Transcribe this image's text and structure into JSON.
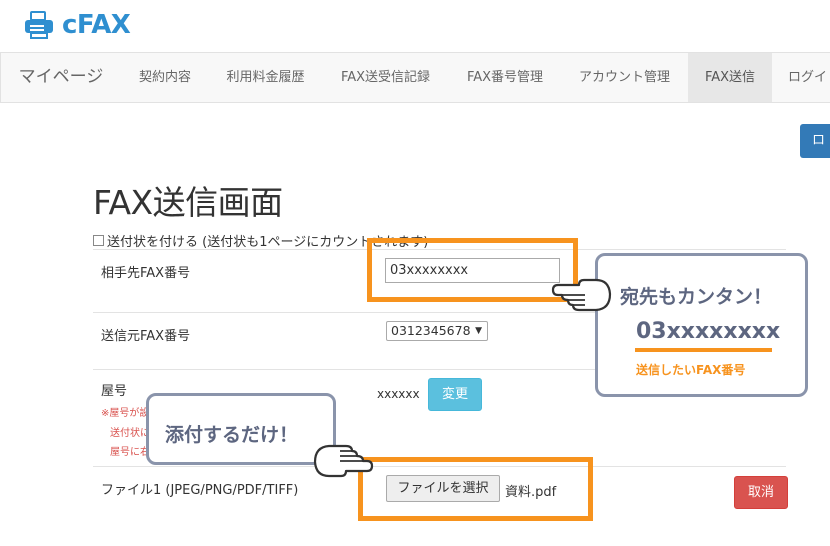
{
  "brand": {
    "logo_text": "cFAX"
  },
  "nav": {
    "home": "マイページ",
    "items": [
      "契約内容",
      "利用料金履歴",
      "FAX送受信記録",
      "FAX番号管理",
      "アカウント管理",
      "FAX送信",
      "ログイ"
    ]
  },
  "logout_label": "ロ",
  "page_title": "FAX送信画面",
  "cover_option": {
    "label": "送付状を付ける (送付状も1ページにカウントされます)",
    "checked": false
  },
  "form": {
    "dest_label": "相手先FAX番号",
    "dest_value": "03xxxxxxxx",
    "sender_label": "送信元FAX番号",
    "sender_value": "0312345678",
    "yago_label": "屋号",
    "yago_value": "xxxxxx",
    "change_button": "変更",
    "yago_notes": [
      "※屋号が設",
      "送付状に",
      "屋号に右"
    ],
    "file_label": "ファイル1 (JPEG/PNG/PDF/TIFF)",
    "file_button": "ファイルを選択",
    "file_name": "資料.pdf",
    "cancel_button": "取消"
  },
  "callouts": {
    "dest_title": "宛先もカンタン！",
    "dest_number": "03xxxxxxxx",
    "dest_caption": "送信したいFAX番号",
    "attach_title": "添付するだけ！"
  },
  "colors": {
    "brand_blue": "#2f8fd0",
    "highlight_orange": "#f7931e",
    "bubble_border": "#8a94ab",
    "info_button": "#5bc0de",
    "danger_button": "#d9534f",
    "primary_button": "#337ab7"
  }
}
